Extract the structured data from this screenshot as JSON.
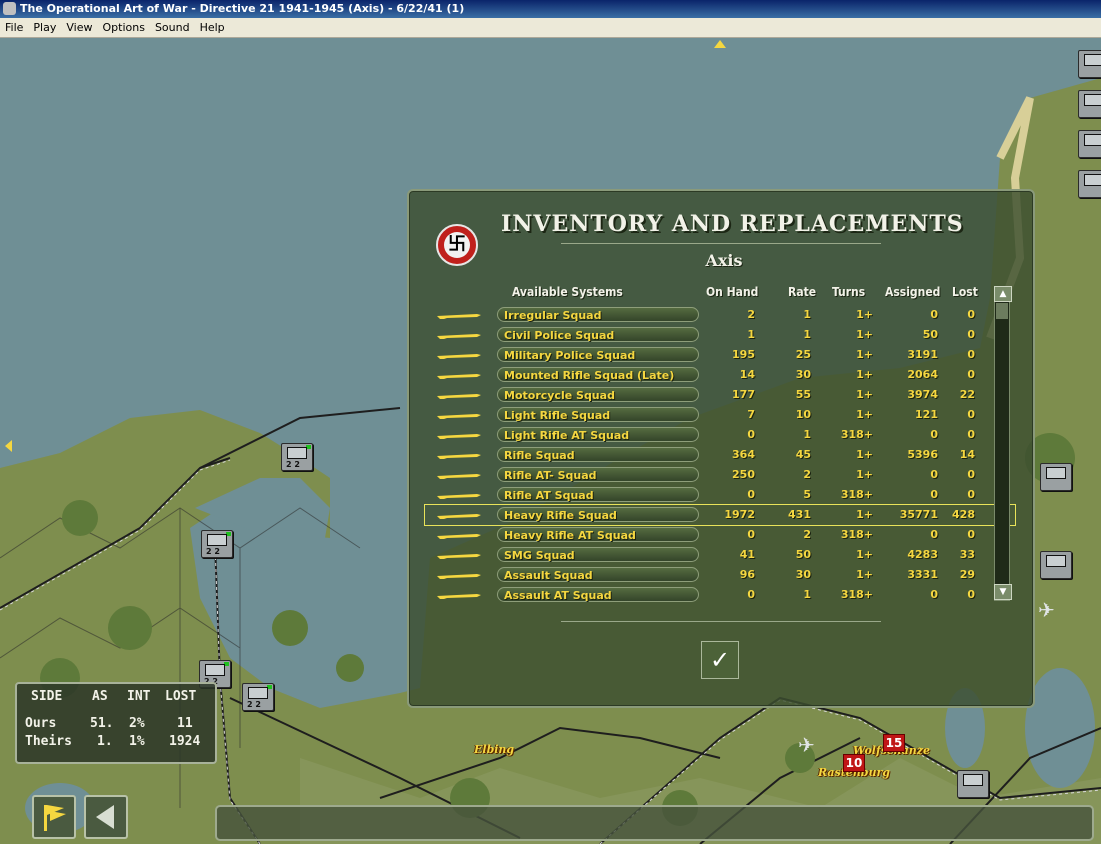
{
  "window": {
    "title": "The Operational Art of War - Directive 21 1941-1945 (Axis) - 6/22/41 (1)"
  },
  "menu": [
    "File",
    "Play",
    "View",
    "Options",
    "Sound",
    "Help"
  ],
  "map": {
    "labels": [
      "Elbing",
      "Wolfschanze",
      "Rastenburg"
    ],
    "victory_points": [
      "15",
      "10"
    ],
    "units": [
      {
        "strength": "2 2"
      },
      {
        "strength": "2 2"
      },
      {
        "strength": "2 2"
      },
      {
        "strength": "2 2"
      }
    ]
  },
  "dialog": {
    "title": "INVENTORY AND REPLACEMENTS",
    "side": "Axis",
    "columns": {
      "systems": "Available Systems",
      "on_hand": "On Hand",
      "rate": "Rate",
      "turns": "Turns",
      "assigned": "Assigned",
      "lost": "Lost"
    },
    "rows": [
      {
        "name": "Irregular Squad",
        "on_hand": "2",
        "rate": "1",
        "turns": "1+",
        "assigned": "0",
        "lost": "0",
        "icon": "rifle-icon"
      },
      {
        "name": "Civil Police Squad",
        "on_hand": "1",
        "rate": "1",
        "turns": "1+",
        "assigned": "50",
        "lost": "0",
        "icon": "rifle-icon"
      },
      {
        "name": "Military Police Squad",
        "on_hand": "195",
        "rate": "25",
        "turns": "1+",
        "assigned": "3191",
        "lost": "0",
        "icon": "rifle-icon"
      },
      {
        "name": "Mounted Rifle Squad (Late)",
        "on_hand": "14",
        "rate": "30",
        "turns": "1+",
        "assigned": "2064",
        "lost": "0",
        "icon": "horse-icon"
      },
      {
        "name": "Motorcycle Squad",
        "on_hand": "177",
        "rate": "55",
        "turns": "1+",
        "assigned": "3974",
        "lost": "22",
        "icon": "motorcycle-icon"
      },
      {
        "name": "Light Rifle Squad",
        "on_hand": "7",
        "rate": "10",
        "turns": "1+",
        "assigned": "121",
        "lost": "0",
        "icon": "rifle-icon"
      },
      {
        "name": "Light Rifle AT Squad",
        "on_hand": "0",
        "rate": "1",
        "turns": "318+",
        "assigned": "0",
        "lost": "0",
        "icon": "rifle-icon"
      },
      {
        "name": "Rifle Squad",
        "on_hand": "364",
        "rate": "45",
        "turns": "1+",
        "assigned": "5396",
        "lost": "14",
        "icon": "rifle-icon"
      },
      {
        "name": "Rifle AT- Squad",
        "on_hand": "250",
        "rate": "2",
        "turns": "1+",
        "assigned": "0",
        "lost": "0",
        "icon": "rifle-icon"
      },
      {
        "name": "Rifle AT Squad",
        "on_hand": "0",
        "rate": "5",
        "turns": "318+",
        "assigned": "0",
        "lost": "0",
        "icon": "rifle-icon"
      },
      {
        "name": "Heavy Rifle Squad",
        "on_hand": "1972",
        "rate": "431",
        "turns": "1+",
        "assigned": "35771",
        "lost": "428",
        "icon": "rifle-icon"
      },
      {
        "name": "Heavy Rifle AT Squad",
        "on_hand": "0",
        "rate": "2",
        "turns": "318+",
        "assigned": "0",
        "lost": "0",
        "icon": "rifle-icon"
      },
      {
        "name": "SMG Squad",
        "on_hand": "41",
        "rate": "50",
        "turns": "1+",
        "assigned": "4283",
        "lost": "33",
        "icon": "smg-icon"
      },
      {
        "name": "Assault Squad",
        "on_hand": "96",
        "rate": "30",
        "turns": "1+",
        "assigned": "3331",
        "lost": "29",
        "icon": "assault-rifle-icon"
      },
      {
        "name": "Assault AT Squad",
        "on_hand": "0",
        "rate": "1",
        "turns": "318+",
        "assigned": "0",
        "lost": "0",
        "icon": "assault-rifle-icon"
      }
    ],
    "selected_row": "Heavy Rifle Squad"
  },
  "stats": {
    "headers": [
      "SIDE",
      "AS",
      "INT",
      "LOST"
    ],
    "rows": [
      {
        "side": "Ours",
        "as": "51.",
        "int": "2%",
        "lost": "11"
      },
      {
        "side": "Theirs",
        "as": "1.",
        "int": "1%",
        "lost": "1924"
      }
    ]
  },
  "colors": {
    "accent_yellow": "#f5d740",
    "dialog_bg": "#3c4e30",
    "water": "#6f8f95",
    "land": "#8a9a5a"
  }
}
